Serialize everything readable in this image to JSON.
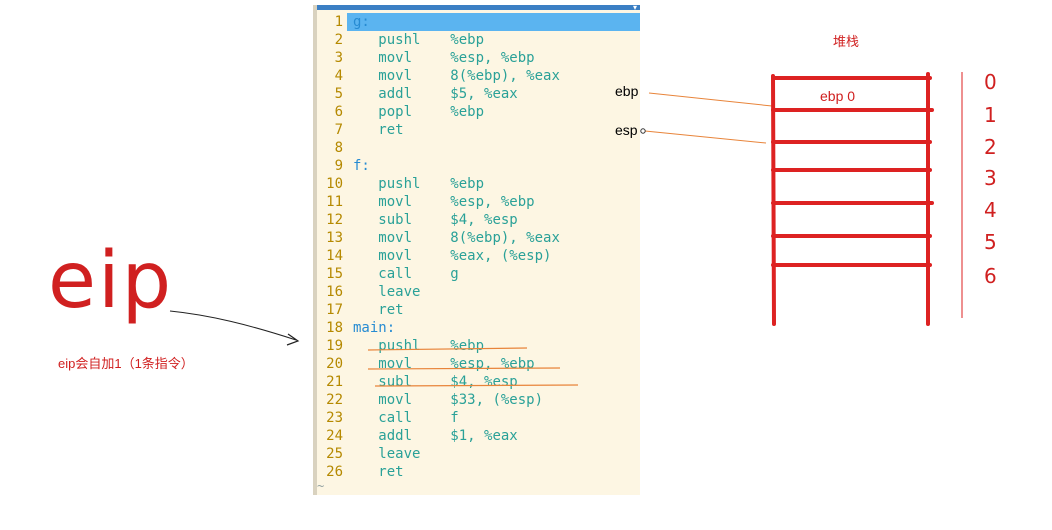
{
  "editor": {
    "lines": [
      {
        "num": "1",
        "label": "g:",
        "mnemonic": "",
        "operands": ""
      },
      {
        "num": "2",
        "label": "",
        "mnemonic": "pushl",
        "operands": "%ebp"
      },
      {
        "num": "3",
        "label": "",
        "mnemonic": "movl",
        "operands": "%esp, %ebp"
      },
      {
        "num": "4",
        "label": "",
        "mnemonic": "movl",
        "operands": "8(%ebp), %eax"
      },
      {
        "num": "5",
        "label": "",
        "mnemonic": "addl",
        "operands": "$5, %eax"
      },
      {
        "num": "6",
        "label": "",
        "mnemonic": "popl",
        "operands": "%ebp"
      },
      {
        "num": "7",
        "label": "",
        "mnemonic": "ret",
        "operands": ""
      },
      {
        "num": "8",
        "label": "",
        "mnemonic": "",
        "operands": ""
      },
      {
        "num": "9",
        "label": "f:",
        "mnemonic": "",
        "operands": ""
      },
      {
        "num": "10",
        "label": "",
        "mnemonic": "pushl",
        "operands": "%ebp"
      },
      {
        "num": "11",
        "label": "",
        "mnemonic": "movl",
        "operands": "%esp, %ebp"
      },
      {
        "num": "12",
        "label": "",
        "mnemonic": "subl",
        "operands": "$4, %esp"
      },
      {
        "num": "13",
        "label": "",
        "mnemonic": "movl",
        "operands": "8(%ebp), %eax"
      },
      {
        "num": "14",
        "label": "",
        "mnemonic": "movl",
        "operands": "%eax, (%esp)"
      },
      {
        "num": "15",
        "label": "",
        "mnemonic": "call",
        "operands": "g"
      },
      {
        "num": "16",
        "label": "",
        "mnemonic": "leave",
        "operands": ""
      },
      {
        "num": "17",
        "label": "",
        "mnemonic": "ret",
        "operands": ""
      },
      {
        "num": "18",
        "label": "main:",
        "mnemonic": "",
        "operands": ""
      },
      {
        "num": "19",
        "label": "",
        "mnemonic": "pushl",
        "operands": "%ebp"
      },
      {
        "num": "20",
        "label": "",
        "mnemonic": "movl",
        "operands": "%esp, %ebp"
      },
      {
        "num": "21",
        "label": "",
        "mnemonic": "subl",
        "operands": "$4, %esp"
      },
      {
        "num": "22",
        "label": "",
        "mnemonic": "movl",
        "operands": "$33, (%esp)"
      },
      {
        "num": "23",
        "label": "",
        "mnemonic": "call",
        "operands": "f"
      },
      {
        "num": "24",
        "label": "",
        "mnemonic": "addl",
        "operands": "$1, %eax"
      },
      {
        "num": "25",
        "label": "",
        "mnemonic": "leave",
        "operands": ""
      },
      {
        "num": "26",
        "label": "",
        "mnemonic": "ret",
        "operands": ""
      }
    ],
    "empty_marker": "~"
  },
  "annotations": {
    "eip_big": "eip",
    "eip_note": "eip会自加1（1条指令）",
    "stack_title": "堆栈",
    "ebp_pointer": "ebp",
    "esp_pointer": "esp",
    "stack_cell_0": "ebp 0",
    "index_numbers": [
      "0",
      "1",
      "2",
      "3",
      "4",
      "5",
      "6"
    ]
  },
  "colors": {
    "ink_red": "#dd2222",
    "underline_orange": "#e8843a"
  }
}
